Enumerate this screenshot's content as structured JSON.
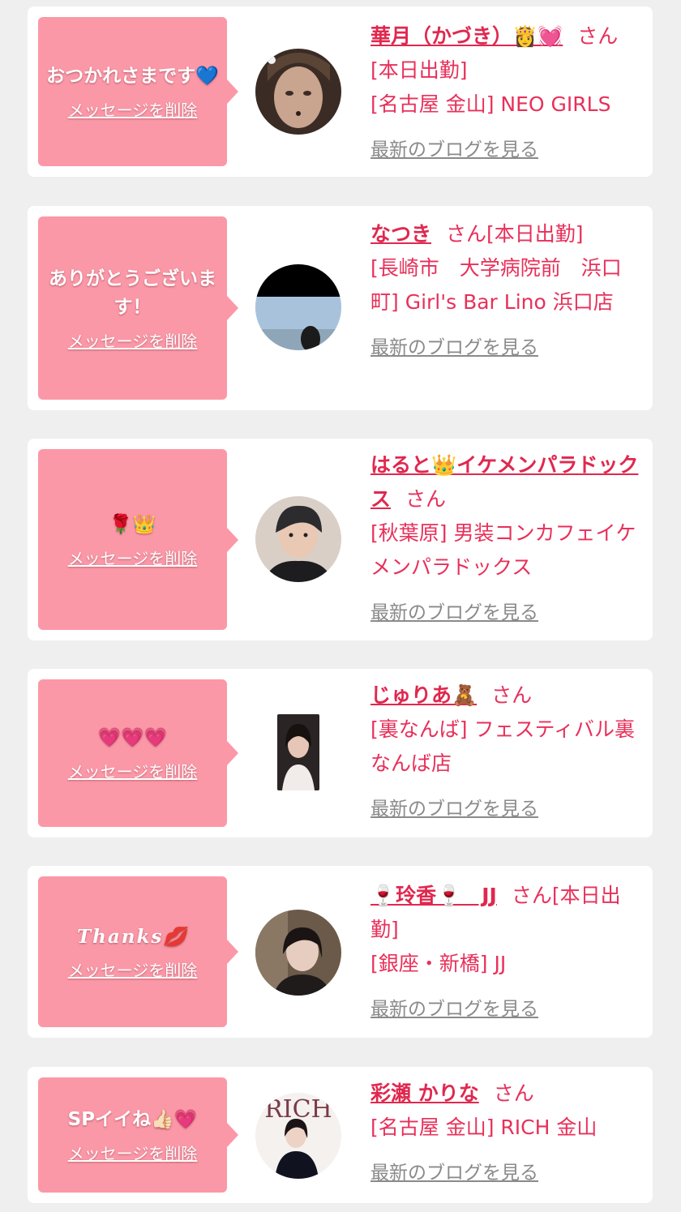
{
  "colors": {
    "page_bg": "#efefef",
    "card_bg": "#ffffff",
    "bubble_bg": "#fb98a7",
    "name_pink": "#e0284f",
    "text_pink": "#e8305a",
    "link_gray": "#8a8a8a"
  },
  "common": {
    "delete_label": "メッセージを削除",
    "blog_label": "最新のブログを見る",
    "san": "さん"
  },
  "messages": [
    {
      "message": "おつかれさまです💙",
      "name": "華月（かづき）👸💓",
      "san_suffix": "さん[本日出勤]",
      "shop": "[名古屋 金山] NEO GIRLS",
      "avatar_icon": "avatar-photo"
    },
    {
      "message": "ありがとうございます！",
      "name": "なつき",
      "san_suffix": "さん[本日出勤]",
      "shop": "[長崎市　大学病院前　浜口町] Girl's Bar Lino 浜口店",
      "avatar_icon": "avatar-photo"
    },
    {
      "message": "🌹👑",
      "name": "はると👑イケメンパラドックス",
      "san_suffix": "さん",
      "shop": "[秋葉原] 男装コンカフェイケメンパラドックス",
      "avatar_icon": "avatar-photo"
    },
    {
      "message": "💗💗💗",
      "name": "じゅりあ🧸",
      "san_suffix": "さん",
      "shop": "[裏なんば] フェスティバル裏なんば店",
      "avatar_icon": "avatar-photo"
    },
    {
      "message": "Thanks💋",
      "name": "🍷玲香🍷　JJ",
      "san_suffix": "さん[本日出勤]",
      "shop": "[銀座・新橋] JJ",
      "avatar_icon": "avatar-photo"
    },
    {
      "message": "SPイイね👍🏻💗",
      "name": "彩瀬 かりな",
      "san_suffix": "さん",
      "shop": "[名古屋 金山] RICH 金山",
      "avatar_icon": "avatar-photo"
    }
  ]
}
